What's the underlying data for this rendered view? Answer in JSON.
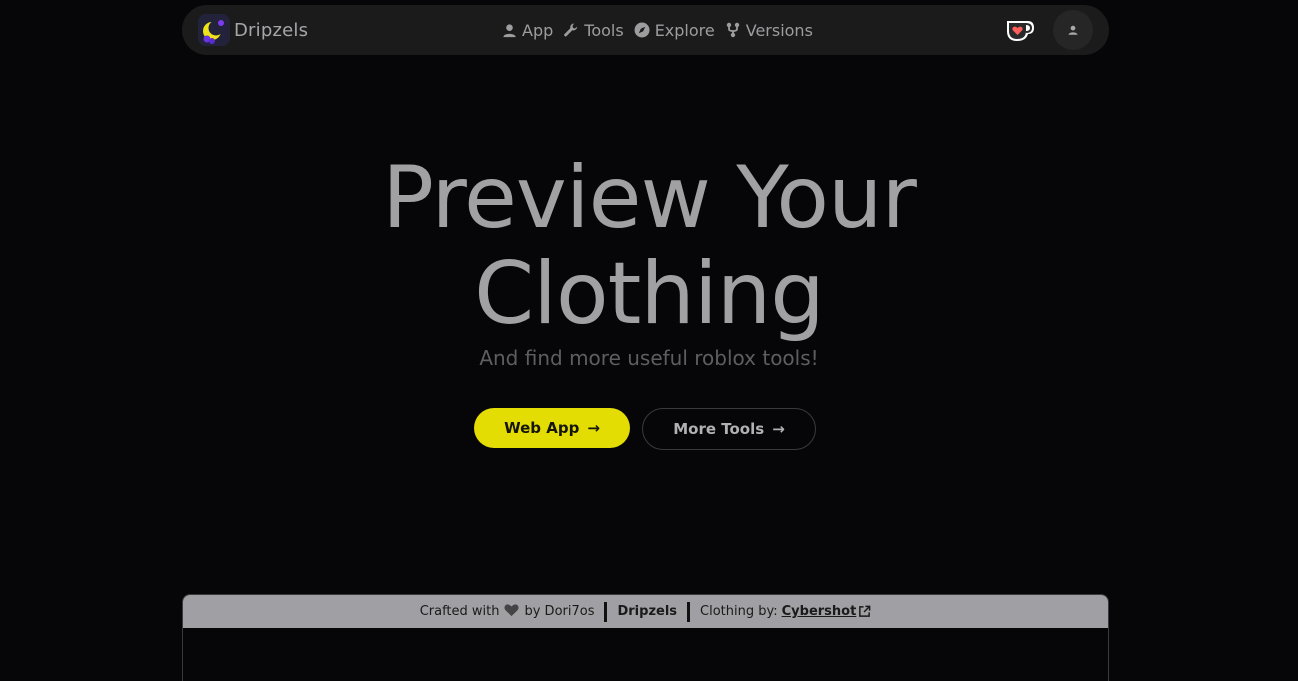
{
  "nav": {
    "brand": "Dripzels",
    "links": [
      {
        "label": "App",
        "icon": "user-icon"
      },
      {
        "label": "Tools",
        "icon": "wrench-icon"
      },
      {
        "label": "Explore",
        "icon": "compass-icon"
      },
      {
        "label": "Versions",
        "icon": "branch-icon"
      }
    ],
    "kofi_icon": "kofi-cup-icon",
    "account_icon": "user-icon"
  },
  "hero": {
    "title_line1": "Preview Your",
    "title_line2": "Clothing",
    "subtitle": "And find more useful roblox tools!",
    "primary_button": "Web App",
    "secondary_button": "More Tools",
    "arrow": "→"
  },
  "credits": {
    "crafted_prefix": "Crafted with",
    "crafted_by": "by Dori7os",
    "site": "Dripzels",
    "clothing_label": "Clothing by:",
    "clothing_author": "Cybershot"
  },
  "colors": {
    "accent": "#e3dd04",
    "background": "#060608",
    "navbar": "#1b1b1b",
    "credit_bar": "#a0a0a4"
  }
}
